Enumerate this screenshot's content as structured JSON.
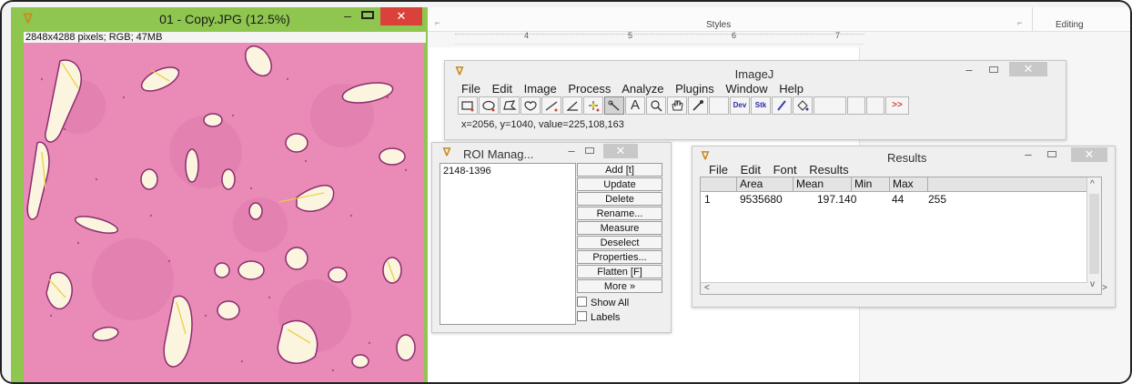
{
  "image_window": {
    "title": "01 - Copy.JPG (12.5%)",
    "info": "2848x4288 pixels; RGB; 47MB",
    "controls": {
      "minimize": "–",
      "close": "✕"
    }
  },
  "word": {
    "styles_label": "Styles",
    "editing_label": "Editing",
    "launcher": "⌐",
    "ruler_ticks": [
      "4",
      "5",
      "6",
      "7"
    ]
  },
  "imagej": {
    "title": "ImageJ",
    "menu": [
      "File",
      "Edit",
      "Image",
      "Process",
      "Analyze",
      "Plugins",
      "Window",
      "Help"
    ],
    "tools": {
      "text": "A",
      "dev": "Dev",
      "stk": "Stk",
      "more": ">>"
    },
    "status": "x=2056, y=1040, value=225,108,163",
    "controls": {
      "minimize": "–",
      "close": "✕"
    }
  },
  "roi_manager": {
    "title": "ROI Manag...",
    "list_items": [
      "2148-1396"
    ],
    "buttons": [
      "Add [t]",
      "Update",
      "Delete",
      "Rename...",
      "Measure",
      "Deselect",
      "Properties...",
      "Flatten [F]",
      "More »"
    ],
    "checkboxes": [
      "Show All",
      "Labels"
    ],
    "controls": {
      "minimize": "–",
      "close": "✕"
    }
  },
  "results": {
    "title": "Results",
    "menu": [
      "File",
      "Edit",
      "Font",
      "Results"
    ],
    "columns": [
      "",
      "Area",
      "Mean",
      "Min",
      "Max"
    ],
    "rows": [
      [
        "1",
        "9535680",
        "197.140",
        "44",
        "255"
      ]
    ],
    "controls": {
      "minimize": "–",
      "close": "✕"
    },
    "scroll": {
      "up": "^",
      "down": "v",
      "left": "<",
      "right": ">"
    }
  },
  "colors": {
    "window_frame_green": "#8ec64f",
    "close_red": "#d9413a",
    "tissue_pink": "#e98bb6",
    "lumen_white": "#fbf4df"
  }
}
